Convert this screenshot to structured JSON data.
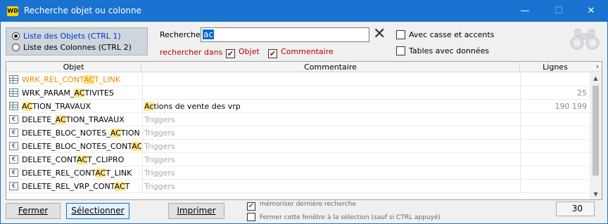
{
  "window": {
    "app_icon": "WD",
    "title": "Recherche objet ou colonne",
    "min_glyph": "—",
    "max_glyph": "☐",
    "close_glyph": "✕"
  },
  "mode": {
    "objects_label": "Liste des Objets (CTRL 1)",
    "columns_label": "Liste des Colonnes (CTRL 2)",
    "selected": "objects"
  },
  "search": {
    "label": "Recherche",
    "value": "ac",
    "clear_glyph": "✕",
    "search_in_label": "rechercher dans :",
    "in_object_label": "Objet",
    "in_object_checked": true,
    "in_comment_label": "Commentaire",
    "in_comment_checked": true,
    "case_label": "Avec casse et accents",
    "case_checked": false,
    "tables_data_label": "Tables avec données",
    "tables_data_checked": false,
    "binoculars_icon": "binoculars-icon"
  },
  "grid": {
    "columns": [
      "Objet",
      "Commentaire",
      "Lignes"
    ],
    "scroll_right_glyph": "›",
    "rows": [
      {
        "icon": "table",
        "pre": "WRK_REL_CONT",
        "hl": "AC",
        "post": "T_LINK",
        "c_pre": "",
        "c_hl": "",
        "c_post": "",
        "comment_gray": false,
        "lines": "",
        "style": "orange"
      },
      {
        "icon": "table",
        "pre": "WRK_PARAM_",
        "hl": "AC",
        "post": "TIVITES",
        "c_pre": "",
        "c_hl": "",
        "c_post": "",
        "comment_gray": false,
        "lines": "25",
        "style": ""
      },
      {
        "icon": "table",
        "pre": "",
        "hl": "AC",
        "post": "TION_TRAVAUX",
        "c_pre": "",
        "c_hl": "Ac",
        "c_post": "tions de vente des vrp",
        "comment_gray": false,
        "lines": "190 199",
        "style": ""
      },
      {
        "icon": "trigger",
        "pre": "DELETE_",
        "hl": "AC",
        "post": "TION_TRAVAUX",
        "c_pre": "Triggers",
        "c_hl": "",
        "c_post": "",
        "comment_gray": true,
        "lines": "",
        "style": ""
      },
      {
        "icon": "trigger",
        "pre": "DELETE_BLOC_NOTES_",
        "hl": "AC",
        "post": "TION",
        "c_pre": "Triggers",
        "c_hl": "",
        "c_post": "",
        "comment_gray": true,
        "lines": "",
        "style": ""
      },
      {
        "icon": "trigger",
        "pre": "DELETE_BLOC_NOTES_CONT",
        "hl": "AC",
        "post": "T",
        "c_pre": "Triggers",
        "c_hl": "",
        "c_post": "",
        "comment_gray": true,
        "lines": "",
        "style": ""
      },
      {
        "icon": "trigger",
        "pre": "DELETE_CONT",
        "hl": "AC",
        "post": "T_CLIPRO",
        "c_pre": "Triggers",
        "c_hl": "",
        "c_post": "",
        "comment_gray": true,
        "lines": "",
        "style": ""
      },
      {
        "icon": "trigger",
        "pre": "DELETE_REL_CONT",
        "hl": "AC",
        "post": "T_LINK",
        "c_pre": "Triggers",
        "c_hl": "",
        "c_post": "",
        "comment_gray": true,
        "lines": "",
        "style": ""
      },
      {
        "icon": "trigger",
        "pre": "DELETE_REL_VRP_CONT",
        "hl": "AC",
        "post": "T",
        "c_pre": "Triggers",
        "c_hl": "",
        "c_post": "",
        "comment_gray": true,
        "lines": "",
        "style": ""
      }
    ]
  },
  "footer": {
    "close_label": "Fermer",
    "select_label": "Sélectionner",
    "print_label": "Imprimer",
    "remember_label": "mémoriser dernière recherche",
    "remember_checked": true,
    "close_on_select_label": "Fermer cette fenêtre à la sélection (sauf si CTRL appuyé)",
    "close_on_select_checked": false,
    "count": "30"
  }
}
